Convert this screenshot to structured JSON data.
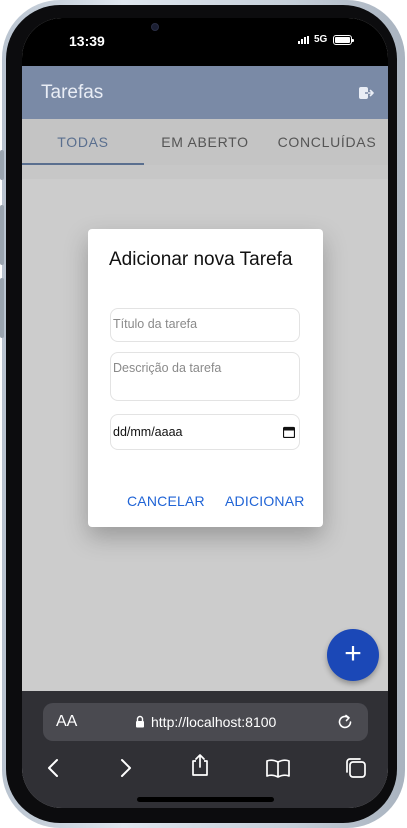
{
  "status_bar": {
    "time": "13:39",
    "network": "5G"
  },
  "app": {
    "title": "Tarefas",
    "accent_color": "#1b48b7"
  },
  "tabs": [
    {
      "label": "TODAS",
      "active": true
    },
    {
      "label": "EM ABERTO",
      "active": false
    },
    {
      "label": "CONCLUÍDAS",
      "active": false
    }
  ],
  "modal": {
    "title": "Adicionar nova Tarefa",
    "title_placeholder": "Título da tarefa",
    "description_placeholder": "Descrição da tarefa",
    "date_value": "dd/mm/aaaa",
    "cancel_label": "CANCELAR",
    "add_label": "ADICIONAR"
  },
  "fab": {
    "label": "+"
  },
  "browser": {
    "text_size_label": "AA",
    "url": "http://localhost:8100"
  },
  "icons": {
    "logout": "logout-icon",
    "calendar": "calendar-icon",
    "lock": "lock-icon",
    "reload": "reload-icon",
    "back": "chevron-left-icon",
    "forward": "chevron-right-icon",
    "share": "share-icon",
    "bookmarks": "book-icon",
    "tabs": "tabs-icon"
  }
}
